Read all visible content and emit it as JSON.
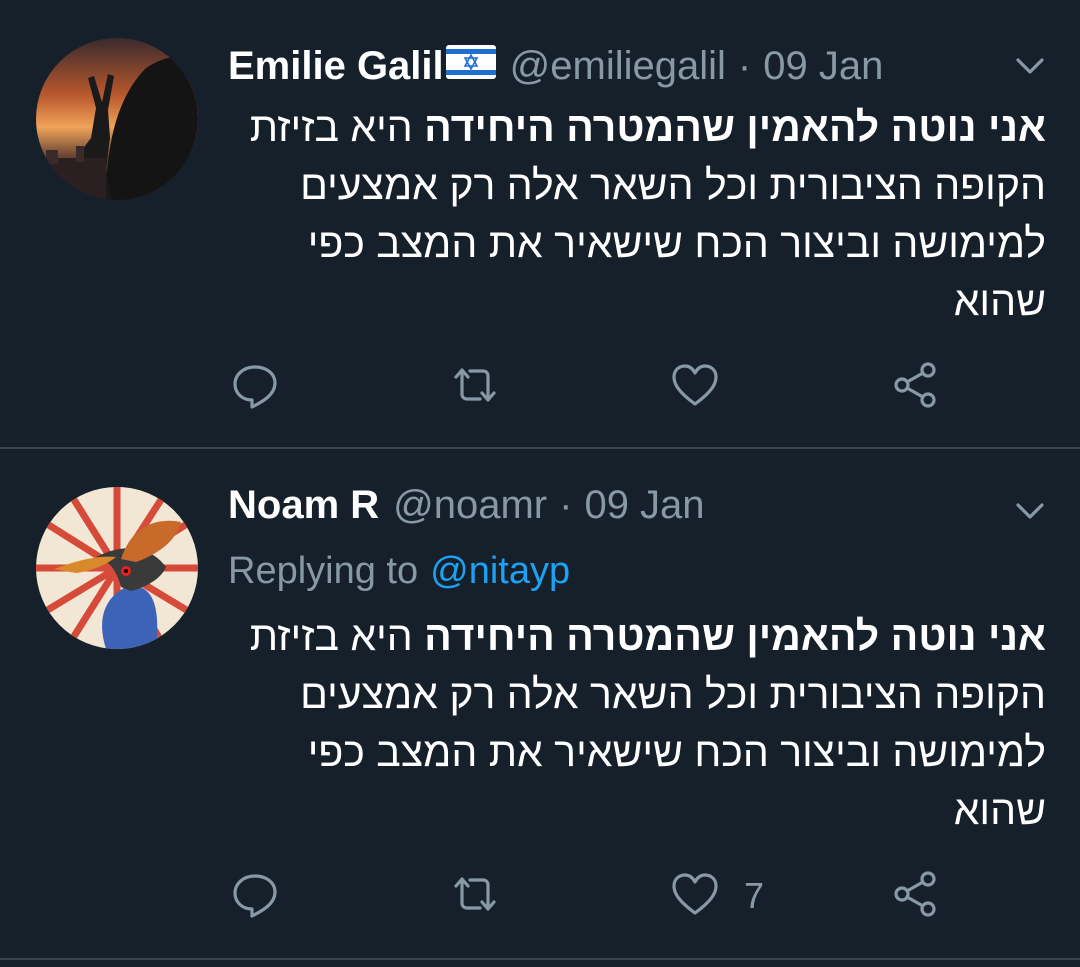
{
  "tweets": [
    {
      "name": "Emilie Galil",
      "handle": "@emiliegalil",
      "separator": "·",
      "date": "09 Jan",
      "replying_label": "",
      "replying_to": "",
      "text_bold": "אני נוטה להאמין שהמטרה היחידה",
      "text_rest": " היא בזיזת הקופה הציבורית וכל השאר אלה רק אמצעים למימושה וביצור הכח שישאיר את המצב כפי שהוא",
      "like_count": "",
      "icons": [
        "chevron-down-icon",
        "reply-icon",
        "retweet-icon",
        "heart-icon",
        "share-icon"
      ]
    },
    {
      "name": "Noam R",
      "handle": "@noamr",
      "separator": "·",
      "date": "09 Jan",
      "replying_label": "Replying to",
      "replying_to": "@nitayp",
      "text_bold": "אני נוטה להאמין שהמטרה היחידה",
      "text_rest": " היא בזיזת הקופה הציבורית וכל השאר אלה רק אמצעים למימושה וביצור הכח שישאיר את המצב כפי שהוא",
      "like_count": "7",
      "icons": [
        "chevron-down-icon",
        "reply-icon",
        "retweet-icon",
        "heart-icon",
        "share-icon"
      ]
    }
  ],
  "colors": {
    "background": "#15202b",
    "text": "#ffffff",
    "muted": "#8899a6",
    "link": "#1da1f2",
    "divider": "#38444d"
  }
}
